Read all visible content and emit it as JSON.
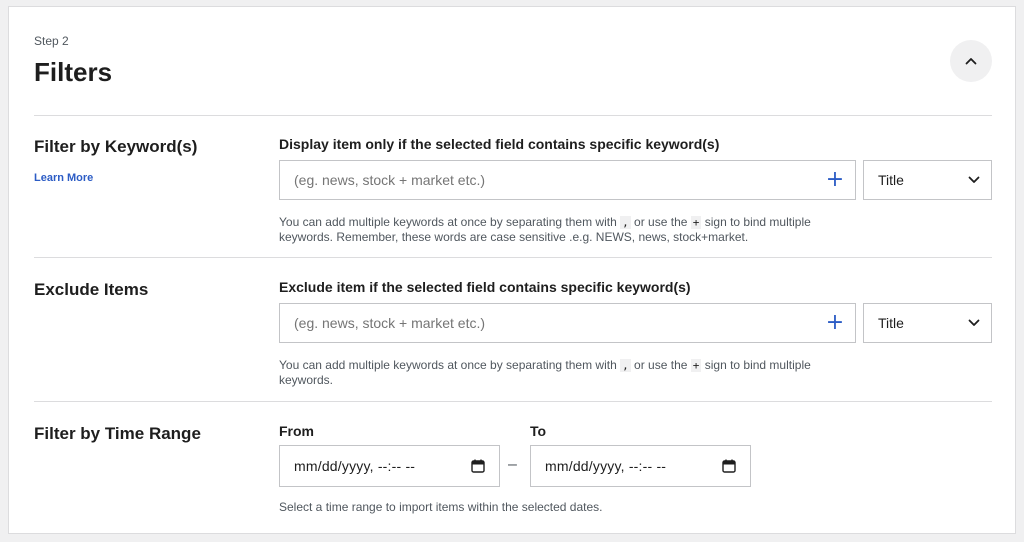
{
  "header": {
    "step_label": "Step 2",
    "title": "Filters",
    "collapse_icon": "chevron-up-icon"
  },
  "keyword_filter": {
    "title": "Filter by Keyword(s)",
    "learn_more": "Learn More",
    "field_label": "Display item only if the selected field contains specific keyword(s)",
    "input_value": "",
    "placeholder": "(eg. news, stock + market etc.)",
    "add_icon": "+",
    "select_value": "Title",
    "help_part1": "You can add multiple keywords at once by separating them with ",
    "help_comma": ",",
    "help_part2": " or use the ",
    "help_plus": "+",
    "help_part3": " sign to bind multiple",
    "help_part4": "keywords. Remember, these words are case sensitive .e.g. NEWS, news, stock+market."
  },
  "exclude_filter": {
    "title": "Exclude Items",
    "field_label": "Exclude item if the selected field contains specific keyword(s)",
    "input_value": "",
    "placeholder": "(eg. news, stock + market etc.)",
    "add_icon": "+",
    "select_value": "Title",
    "help_part1": "You can add multiple keywords at once by separating them with ",
    "help_comma": ",",
    "help_part2": " or use the ",
    "help_plus": "+",
    "help_part3": " sign to bind multiple",
    "help_part4": "keywords."
  },
  "time_filter": {
    "title": "Filter by Time Range",
    "from_label": "From",
    "to_label": "To",
    "from_value": "mm/dd/yyyy, --:-- --",
    "to_value": "mm/dd/yyyy, --:-- --",
    "separator": "–",
    "help": "Select a time range to import items within the selected dates."
  },
  "colors": {
    "accent": "#2c5cc5",
    "border": "#c3c4c7",
    "divider": "#dcdcde",
    "muted_text": "#50575e"
  }
}
